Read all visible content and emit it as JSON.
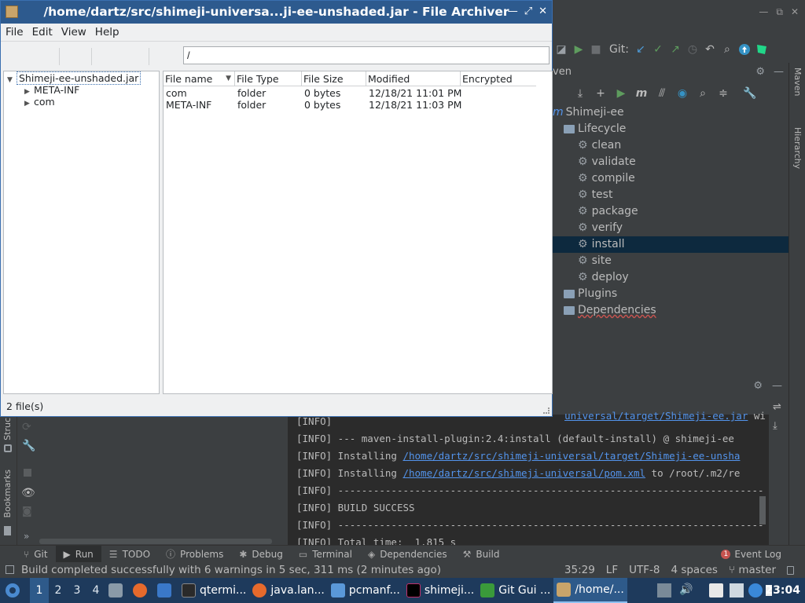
{
  "colors": {
    "ide_bg": "#3c3f41",
    "console_bg": "#2b2b2b",
    "link": "#5394ec",
    "selection": "#0d293e",
    "taskbar": "#1e3a5c",
    "fa_titlebar": "#2d5a8e"
  },
  "archiver": {
    "title": "/home/dartz/src/shimeji-universa...ji-ee-unshaded.jar - File Archiver",
    "menu": {
      "file": "File",
      "edit": "Edit",
      "view": "View",
      "help": "Help"
    },
    "path": "/",
    "tree": {
      "root": "Shimeji-ee-unshaded.jar",
      "children": [
        "META-INF",
        "com"
      ]
    },
    "columns": [
      "File name",
      "File Type",
      "File Size",
      "Modified",
      "Encrypted"
    ],
    "rows": [
      {
        "name": "com",
        "type": "folder",
        "size": "0 bytes",
        "modified": "12/18/21 11:01 PM",
        "encrypted": ""
      },
      {
        "name": "META-INF",
        "type": "folder",
        "size": "0 bytes",
        "modified": "12/18/21 11:03 PM",
        "encrypted": ""
      }
    ],
    "status": "2 file(s)"
  },
  "ide": {
    "git_label": "Git:",
    "maven_header": "ven",
    "maven_tree": {
      "project": "Shimeji-ee",
      "lifecycle": "Lifecycle",
      "goals": [
        "clean",
        "validate",
        "compile",
        "test",
        "package",
        "verify",
        "install",
        "site",
        "deploy"
      ],
      "selected_goal": "install",
      "plugins": "Plugins",
      "dependencies": "Dependencies"
    },
    "right_strip": {
      "maven": "Maven",
      "hierarchy": "Hierarchy"
    },
    "left_strip": {
      "structure": "Struc",
      "bookmarks": "Bookmarks"
    },
    "console_top": {
      "link": "universal/target/Shimeji-ee.jar",
      "rest": " wi"
    },
    "console_lines": [
      {
        "prefix": "[INFO]",
        "text": "",
        "link": "",
        "after": ""
      },
      {
        "prefix": "[INFO]",
        "text": " --- maven-install-plugin:2.4:install (default-install) @ shimeji-ee",
        "link": "",
        "after": ""
      },
      {
        "prefix": "[INFO]",
        "text": " Installing ",
        "link": "/home/dartz/src/shimeji-universal/target/Shimeji-ee-unsha",
        "after": ""
      },
      {
        "prefix": "[INFO]",
        "text": " Installing ",
        "link": "/home/dartz/src/shimeji-universal/pom.xml",
        "after": " to /root/.m2/re"
      },
      {
        "prefix": "[INFO]",
        "text": " ------------------------------------------------------------------------",
        "link": "",
        "after": ""
      },
      {
        "prefix": "[INFO]",
        "text": " BUILD SUCCESS",
        "link": "",
        "after": ""
      },
      {
        "prefix": "[INFO]",
        "text": " ------------------------------------------------------------------------",
        "link": "",
        "after": ""
      },
      {
        "prefix": "[INFO]",
        "text": " Total time:  1.815 s",
        "link": "",
        "after": ""
      }
    ],
    "tool_tabs": [
      "Git",
      "Run",
      "TODO",
      "Problems",
      "Debug",
      "Terminal",
      "Dependencies",
      "Build"
    ],
    "active_tab": "Run",
    "event_log": "Event Log",
    "event_count": "1",
    "status_message": "Build completed successfully with 6 warnings in 5 sec, 311 ms (2 minutes ago)",
    "status_right": {
      "position": "35:29",
      "line_sep": "LF",
      "encoding": "UTF-8",
      "indent": "4 spaces",
      "branch": "master"
    }
  },
  "taskbar": {
    "workspaces": [
      "1",
      "2",
      "3",
      "4"
    ],
    "active_workspace": "1",
    "items": [
      {
        "label": "qtermi...",
        "icon": "terminal-icon"
      },
      {
        "label": "java.lan...",
        "icon": "firefox-icon"
      },
      {
        "label": "pcmanf...",
        "icon": "folder-icon"
      },
      {
        "label": "shimeji...",
        "icon": "intellij-icon"
      },
      {
        "label": "Git Gui ...",
        "icon": "git-gui-icon"
      },
      {
        "label": "/home/...",
        "icon": "archive-icon"
      }
    ],
    "active_item": "/home/...",
    "clock": "23:04"
  }
}
